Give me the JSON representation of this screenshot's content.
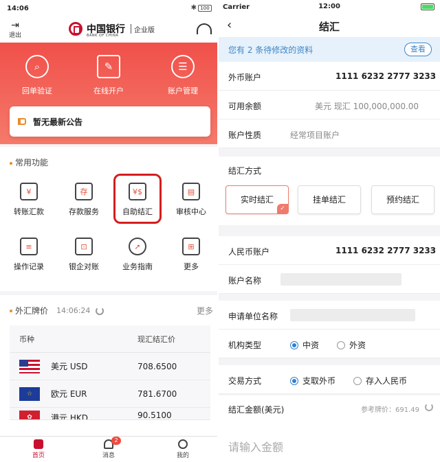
{
  "left": {
    "status": {
      "time": "14:06",
      "battery": "100"
    },
    "header": {
      "logout": "退出",
      "brand_cn": "中国银行",
      "brand_en": "BANK OF CHINA",
      "edition": "企业版"
    },
    "banner": [
      {
        "label": "回单验证",
        "icon": "receipt-verify-icon"
      },
      {
        "label": "在线开户",
        "icon": "edit-icon"
      },
      {
        "label": "账户管理",
        "icon": "user-manage-icon"
      }
    ],
    "notice": "暂无最新公告",
    "common_title": "常用功能",
    "functions": [
      {
        "label": "转账汇款",
        "icon": "transfer-icon"
      },
      {
        "label": "存款服务",
        "icon": "deposit-icon"
      },
      {
        "label": "自助结汇",
        "icon": "fx-settle-icon"
      },
      {
        "label": "审核中心",
        "icon": "review-icon"
      },
      {
        "label": "操作记录",
        "icon": "record-icon"
      },
      {
        "label": "银企对账",
        "icon": "reconcile-icon"
      },
      {
        "label": "业务指南",
        "icon": "compass-icon"
      },
      {
        "label": "更多",
        "icon": "grid-icon"
      }
    ],
    "fx": {
      "title": "外汇牌价",
      "time": "14:06:24",
      "more": "更多",
      "col_currency": "币种",
      "col_rate": "现汇结汇价",
      "rows": [
        {
          "name": "美元 USD",
          "rate": "708.6500"
        },
        {
          "name": "欧元 EUR",
          "rate": "781.6700"
        },
        {
          "name": "港元 HKD",
          "rate": "90.5100"
        }
      ]
    },
    "tabs": [
      {
        "label": "首页"
      },
      {
        "label": "消息",
        "badge": "2"
      },
      {
        "label": "我的"
      }
    ]
  },
  "right": {
    "status": {
      "carrier": "Carrier",
      "time": "12:00"
    },
    "nav": {
      "back": "‹",
      "title": "结汇"
    },
    "pending": {
      "text": "您有 2 条待修改的资料",
      "button": "查看"
    },
    "fx_account": {
      "label": "外币账户",
      "value": "1111 6232 2777 3233"
    },
    "balance": {
      "label": "可用余额",
      "value": "美元 现汇 100,000,000.00"
    },
    "nature": {
      "label": "账户性质",
      "value": "经常项目账户"
    },
    "method": {
      "label": "结汇方式",
      "options": [
        "实时结汇",
        "挂单结汇",
        "预约结汇"
      ]
    },
    "rmb_account": {
      "label": "人民币账户",
      "value": "1111 6232 2777 3233"
    },
    "account_name": {
      "label": "账户名称"
    },
    "applicant": {
      "label": "申请单位名称"
    },
    "org_type": {
      "label": "机构类型",
      "options": [
        "中资",
        "外资"
      ]
    },
    "trade_mode": {
      "label": "交易方式",
      "options": [
        "支取外币",
        "存入人民币"
      ]
    },
    "amount": {
      "label": "结汇金额(美元)",
      "ref": "参考牌价：691.49",
      "placeholder": "请输入金额"
    }
  }
}
